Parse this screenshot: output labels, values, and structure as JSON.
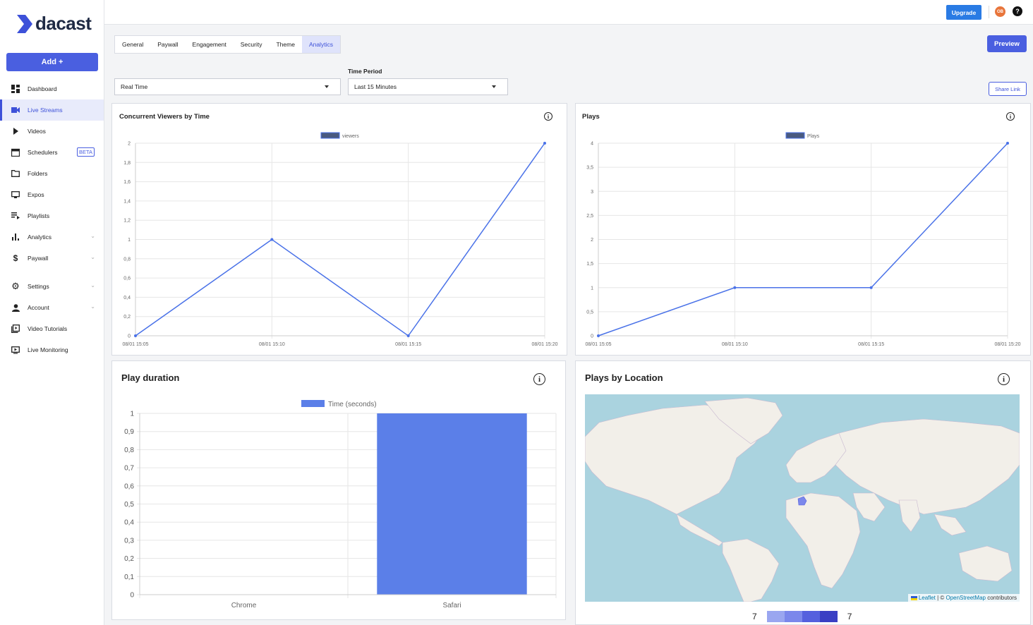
{
  "brand": {
    "name": "dacast"
  },
  "sidebar": {
    "add_label": "Add +",
    "items": [
      {
        "label": "Dashboard"
      },
      {
        "label": "Live Streams"
      },
      {
        "label": "Videos"
      },
      {
        "label": "Schedulers",
        "badge": "BETA"
      },
      {
        "label": "Folders"
      },
      {
        "label": "Expos"
      },
      {
        "label": "Playlists"
      },
      {
        "label": "Analytics"
      },
      {
        "label": "Paywall"
      },
      {
        "label": "Settings"
      },
      {
        "label": "Account"
      },
      {
        "label": "Video Tutorials"
      },
      {
        "label": "Live Monitoring"
      }
    ]
  },
  "topbar": {
    "upgrade_label": "Upgrade",
    "avatar_initials": "OB",
    "help_glyph": "?"
  },
  "tabs": [
    "General",
    "Paywall",
    "Engagement",
    "Security",
    "Theme",
    "Analytics"
  ],
  "actions": {
    "preview_label": "Preview",
    "share_label": "Share Link"
  },
  "filters": {
    "mode_value": "Real Time",
    "time_period_label": "Time Period",
    "time_period_value": "Last 15 Minutes"
  },
  "cards": {
    "viewers_title": "Concurrent Viewers by Time",
    "plays_title": "Plays",
    "duration_title": "Play duration",
    "location_title": "Plays by Location",
    "info_glyph": "i"
  },
  "map": {
    "attribution_leaflet": "Leaflet",
    "attribution_sep": " | © ",
    "attribution_osm": "OpenStreetMap",
    "attribution_rest": " contributors",
    "scale_min": "7",
    "scale_max": "7",
    "scale_colors": [
      "#9aa6f0",
      "#7b87eb",
      "#5560de",
      "#3a3fc4"
    ]
  },
  "chart_data": [
    {
      "type": "line",
      "title": "Concurrent Viewers by Time",
      "x": [
        "08/01 15:05",
        "08/01 15:10",
        "08/01 15:15",
        "08/01 15:20"
      ],
      "series": [
        {
          "name": "viewers",
          "values": [
            0,
            1,
            0,
            2
          ]
        }
      ],
      "yticks": [
        "0",
        "0,2",
        "0,4",
        "0,6",
        "0,8",
        "1",
        "1,2",
        "1,4",
        "1,6",
        "1,8",
        "2"
      ],
      "ylim": [
        0,
        2
      ],
      "color": "#4a72e8",
      "legend": "top-center",
      "grid": true
    },
    {
      "type": "line",
      "title": "Plays",
      "x": [
        "08/01 15:05",
        "08/01 15:10",
        "08/01 15:15",
        "08/01 15:20"
      ],
      "series": [
        {
          "name": "Plays",
          "values": [
            0,
            1,
            1,
            4
          ]
        }
      ],
      "yticks": [
        "0",
        "0,5",
        "1",
        "1,5",
        "2",
        "2,5",
        "3",
        "3,5",
        "4"
      ],
      "ylim": [
        0,
        4
      ],
      "color": "#4a72e8",
      "legend": "top-center",
      "grid": true
    },
    {
      "type": "bar",
      "title": "Play duration",
      "categories": [
        "Chrome",
        "Safari"
      ],
      "series": [
        {
          "name": "Time (seconds)",
          "values": [
            0,
            1
          ]
        }
      ],
      "yticks": [
        "0",
        "0,1",
        "0,2",
        "0,3",
        "0,4",
        "0,5",
        "0,6",
        "0,7",
        "0,8",
        "0,9",
        "1"
      ],
      "ylim": [
        0,
        1
      ],
      "color": "#5b7fe8",
      "legend": "top-center",
      "grid": true
    }
  ]
}
